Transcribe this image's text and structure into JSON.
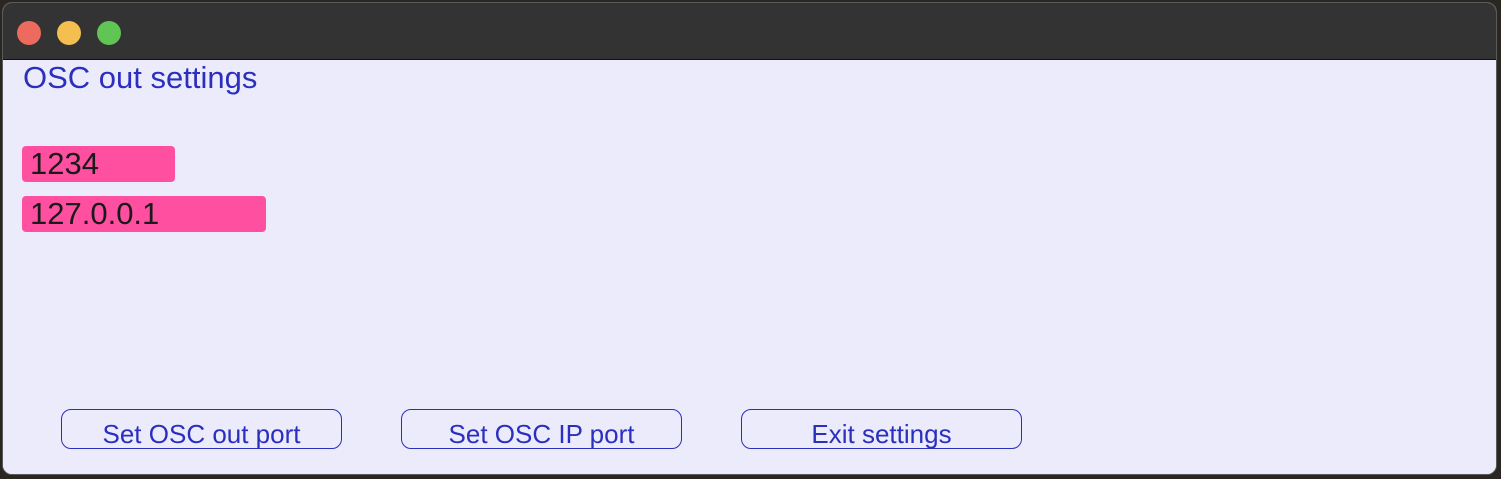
{
  "window": {
    "controls": [
      {
        "name": "close",
        "color": "#ed6a5e"
      },
      {
        "name": "minimize",
        "color": "#f4bf4f"
      },
      {
        "name": "zoom",
        "color": "#61c554"
      }
    ]
  },
  "panel": {
    "title": "OSC out settings",
    "port_field": {
      "value": "1234",
      "color": "#ff4fa0"
    },
    "ip_field": {
      "value": "127.0.0.1",
      "color": "#ff4fa0"
    },
    "buttons": {
      "set_out_port": "Set OSC out port",
      "set_ip_port": "Set OSC IP port",
      "exit": "Exit settings"
    }
  },
  "colors": {
    "accent": "#2b2fbd",
    "background": "#ebebfb",
    "titlebar": "#333333"
  }
}
